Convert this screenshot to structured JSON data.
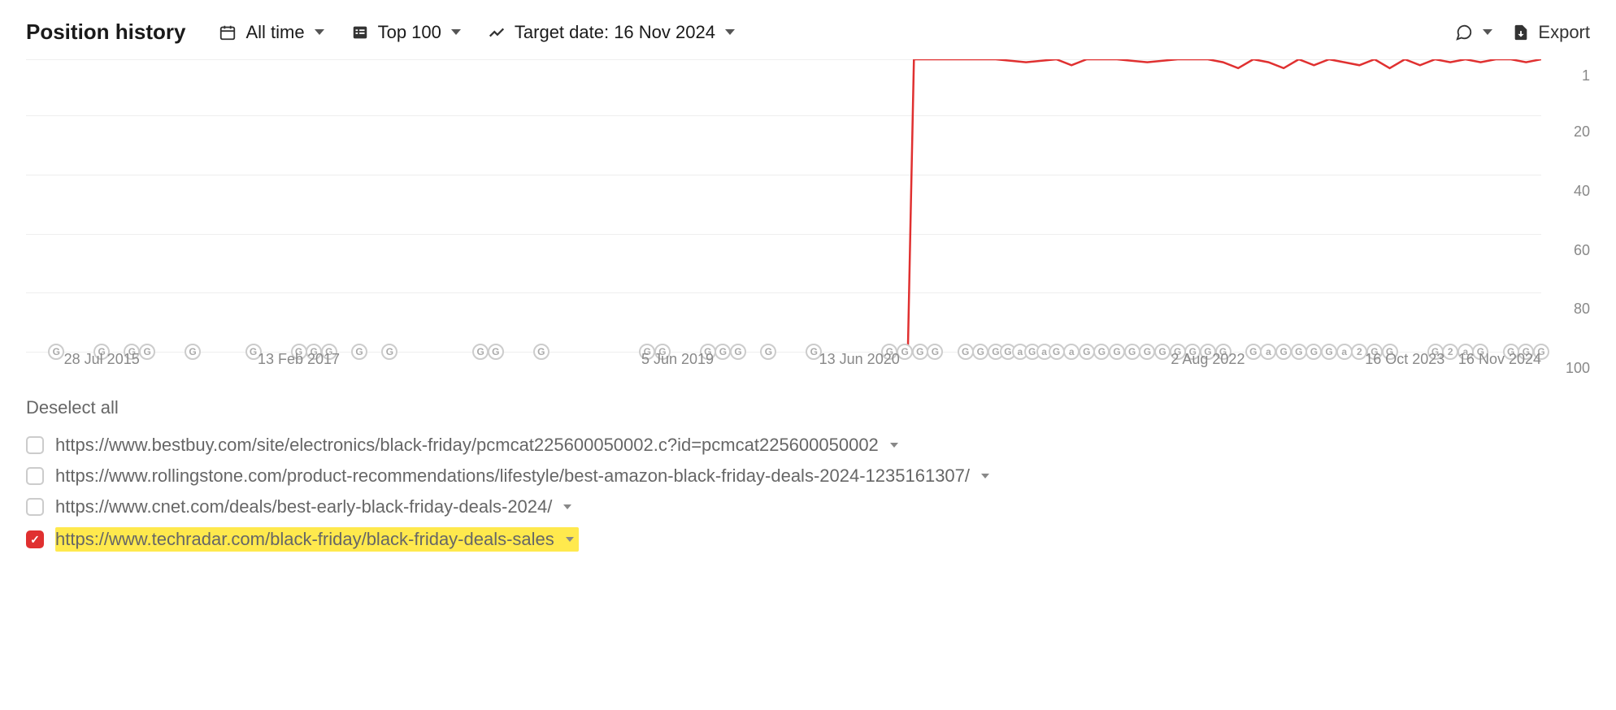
{
  "toolbar": {
    "title": "Position history",
    "time_label": "All time",
    "top_label": "Top 100",
    "target_label": "Target date: 16 Nov 2024",
    "export_label": "Export"
  },
  "chart_data": {
    "type": "line",
    "title": "",
    "xlabel": "",
    "ylabel": "",
    "ylim": [
      1,
      100
    ],
    "y_inverted": true,
    "y_ticks": [
      1,
      20,
      40,
      60,
      80,
      100
    ],
    "x_tick_labels": [
      "28 Jul 2015",
      "13 Feb 2017",
      "5 Jun 2019",
      "13 Jun 2020",
      "2 Aug 2022",
      "16 Oct 2023",
      "16 Nov 2024"
    ],
    "x_tick_positions_pct": [
      5,
      18,
      43,
      55,
      78,
      91,
      100
    ],
    "series": [
      {
        "name": "techradar",
        "color": "#e03030",
        "segments": [
          {
            "x_pct": [
              58.2,
              58.4,
              58.6
            ],
            "y": [
              100,
              50,
              1
            ]
          },
          {
            "x_pct": [
              58.6,
              62,
              64,
              66,
              68,
              69,
              70,
              72,
              74,
              76,
              78,
              79,
              80,
              81,
              82,
              83,
              84,
              85,
              86,
              87,
              88,
              89,
              90,
              91,
              92,
              93,
              94,
              95,
              96,
              97,
              98,
              99,
              100
            ],
            "y": [
              1,
              1,
              1,
              2,
              1,
              3,
              1,
              1,
              2,
              1,
              1,
              2,
              4,
              1,
              2,
              4,
              1,
              3,
              1,
              2,
              3,
              1,
              4,
              1,
              3,
              1,
              2,
              1,
              2,
              1,
              1,
              2,
              1
            ]
          }
        ]
      }
    ],
    "markers_x_pct": [
      2,
      5,
      7,
      8,
      11,
      15,
      18,
      19,
      20,
      22,
      24,
      30,
      31,
      34,
      41,
      42,
      45,
      46,
      47,
      49,
      52,
      57,
      58,
      59,
      60,
      62,
      63,
      64,
      64.8,
      65.6,
      66.4,
      67.2,
      68,
      69,
      70,
      71,
      72,
      73,
      74,
      75,
      76,
      77,
      78,
      79,
      81,
      82,
      83,
      84,
      85,
      86,
      87,
      88,
      89,
      90,
      93,
      94,
      95,
      96,
      98,
      99,
      100
    ],
    "marker_labels": [
      "G",
      "G",
      "G",
      "G",
      "G",
      "G",
      "G",
      "G",
      "G",
      "G",
      "G",
      "G",
      "G",
      "G",
      "G",
      "G",
      "G",
      "G",
      "G",
      "G",
      "G",
      "G",
      "G",
      "G",
      "G",
      "G",
      "G",
      "G",
      "G",
      "a",
      "G",
      "a",
      "G",
      "a",
      "G",
      "G",
      "G",
      "G",
      "G",
      "G",
      "G",
      "G",
      "G",
      "G",
      "G",
      "a",
      "G",
      "G",
      "G",
      "G",
      "a",
      "2",
      "G",
      "G",
      "G",
      "2",
      "a",
      "G",
      "G",
      "G",
      "G"
    ]
  },
  "legend": {
    "deselect_label": "Deselect all",
    "items": [
      {
        "checked": false,
        "url": "https://www.bestbuy.com/site/electronics/black-friday/pcmcat225600050002.c?id=pcmcat225600050002"
      },
      {
        "checked": false,
        "url": "https://www.rollingstone.com/product-recommendations/lifestyle/best-amazon-black-friday-deals-2024-1235161307/"
      },
      {
        "checked": false,
        "url": "https://www.cnet.com/deals/best-early-black-friday-deals-2024/"
      },
      {
        "checked": true,
        "url": "https://www.techradar.com/black-friday/black-friday-deals-sales",
        "highlight": true
      }
    ]
  }
}
